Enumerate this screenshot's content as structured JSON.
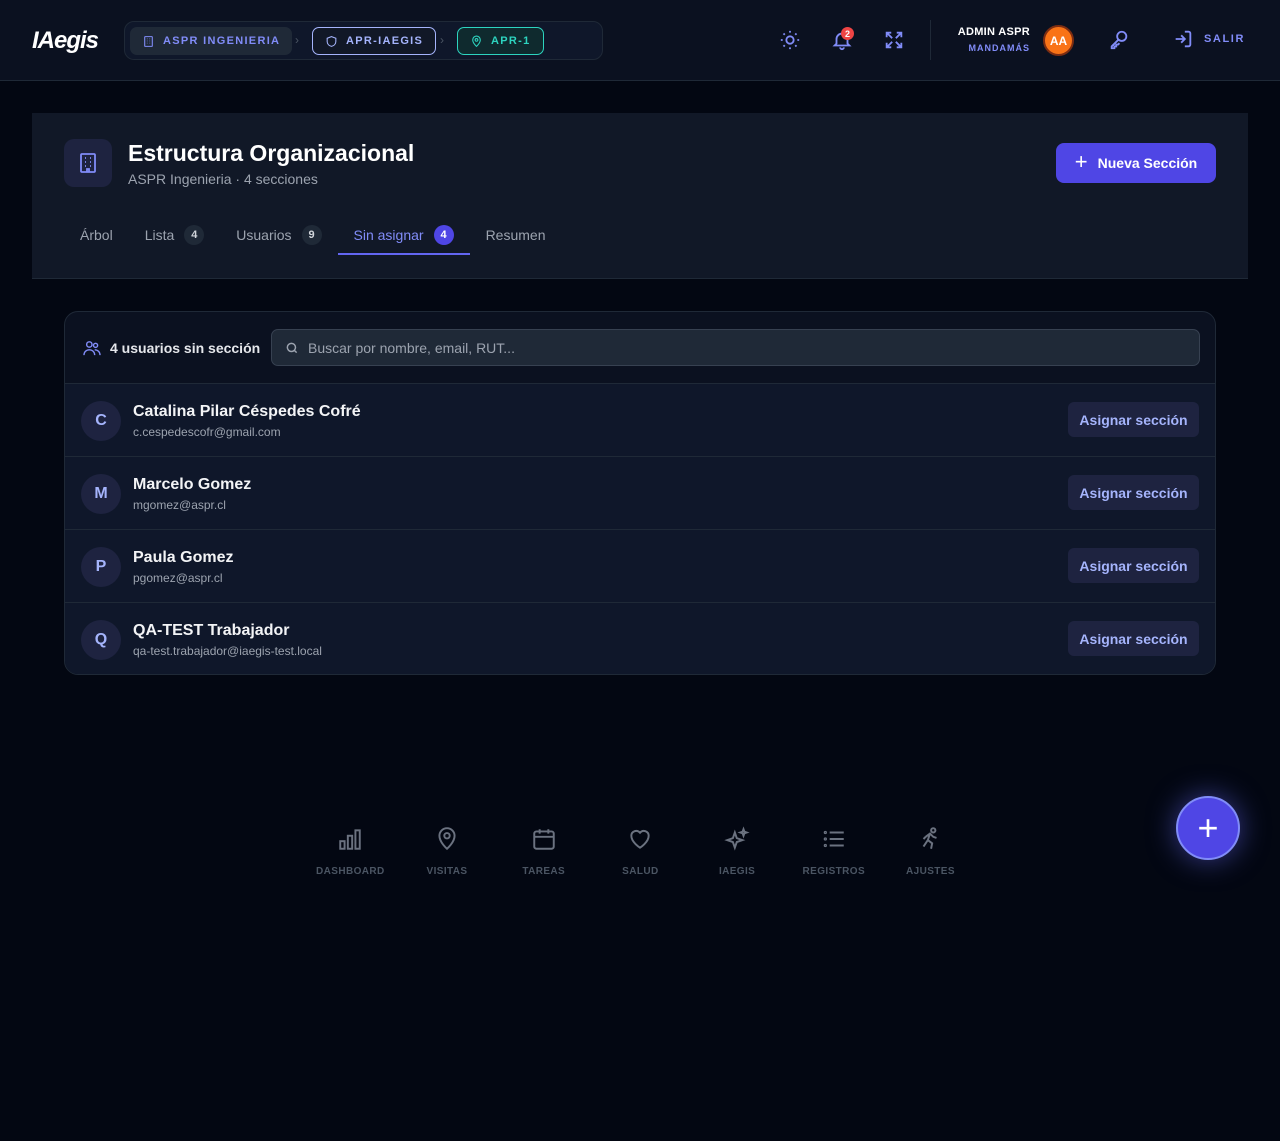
{
  "topbar": {
    "logo": "IAegis",
    "breadcrumbs": [
      {
        "label": "ASPR INGENIERIA",
        "icon": "building-icon"
      },
      {
        "label": "APR-IAEGIS",
        "icon": "shield-icon"
      },
      {
        "label": "APR-1",
        "icon": "map-pin-icon"
      }
    ],
    "notifications_count": "2",
    "user_name": "ADMIN ASPR",
    "user_role": "MANDAMÁS",
    "user_initials": "AA",
    "logout_label": "SALIR"
  },
  "header": {
    "title": "Estructura Organizacional",
    "subtitle": "ASPR Ingenieria · 4 secciones",
    "new_button": "Nueva Sección",
    "tabs": [
      {
        "label": "Árbol",
        "count": ""
      },
      {
        "label": "Lista",
        "count": "4"
      },
      {
        "label": "Usuarios",
        "count": "9"
      },
      {
        "label": "Sin asignar",
        "count": "4"
      },
      {
        "label": "Resumen",
        "count": ""
      }
    ],
    "active_tab": "Sin asignar"
  },
  "unassigned": {
    "label": "4 usuarios sin sección",
    "search_placeholder": "Buscar por nombre, email, RUT...",
    "assign_label": "Asignar sección",
    "users": [
      {
        "initial": "C",
        "name": "Catalina Pilar Céspedes Cofré",
        "email": "c.cespedescofr@gmail.com"
      },
      {
        "initial": "M",
        "name": "Marcelo Gomez",
        "email": "mgomez@aspr.cl"
      },
      {
        "initial": "P",
        "name": "Paula Gomez",
        "email": "pgomez@aspr.cl"
      },
      {
        "initial": "Q",
        "name": "QA-TEST Trabajador",
        "email": "qa-test.trabajador@iaegis-test.local"
      }
    ]
  },
  "bottom_nav": [
    {
      "label": "DASHBOARD",
      "icon": "bar-chart-icon"
    },
    {
      "label": "VISITAS",
      "icon": "map-pin-icon"
    },
    {
      "label": "TAREAS",
      "icon": "calendar-icon"
    },
    {
      "label": "SALUD",
      "icon": "heart-icon"
    },
    {
      "label": "IAEGIS",
      "icon": "sparkles-icon"
    },
    {
      "label": "REGISTROS",
      "icon": "list-icon"
    },
    {
      "label": "AJUSTES",
      "icon": "runner-icon"
    }
  ],
  "fab_icon": "plus-icon",
  "colors": {
    "accent": "#4f46e5",
    "accent_text": "#818cf8",
    "teal": "#2dd4bf",
    "badge_red": "#ef4444",
    "avatar_orange": "#f97316"
  }
}
